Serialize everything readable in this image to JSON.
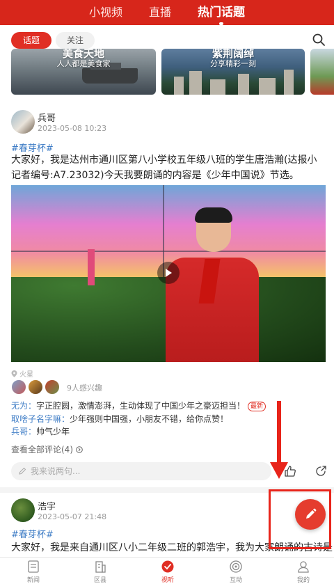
{
  "top_tabs": [
    {
      "label": "小视频"
    },
    {
      "label": "直播"
    },
    {
      "label": "热门话题"
    }
  ],
  "filters": {
    "topic": "话题",
    "follow": "关注"
  },
  "banners": [
    {
      "title": "美食天地",
      "subtitle": "人人都是美食家"
    },
    {
      "title": "紫荆阔绰",
      "subtitle": "分享精彩一刻"
    }
  ],
  "post1": {
    "author": "兵哥",
    "time": "2023-05-08 10:23",
    "hashtag": "#春芽杯#",
    "text": "大家好，我是达州市通川区第八小学校五年级八班的学生唐浩瀚(达报小记者编号:A7.23032)今天我要朗诵的内容是《少年中国说》节选。",
    "location": "火星",
    "interest_count": "9人感兴趣",
    "comments": [
      {
        "who": "无为：",
        "text": "字正腔圆，激情澎湃，生动体现了中国少年之豪迈担当！",
        "badge": "最新"
      },
      {
        "who": "取啥子名字嘛：",
        "text": "少年强则中国强，小朋友不错，给你点赞！"
      },
      {
        "who": "兵哥：",
        "text": "帅气少年"
      }
    ],
    "view_all": "查看全部评论(4)",
    "comment_placeholder": "我来说两句..."
  },
  "post2": {
    "author": "浩宇",
    "time": "2023-05-07 21:48",
    "hashtag": "#春芽杯#",
    "text": "大家好，我是来自通川区八小二年级二班的郭浩宇，我为大家朗诵的古诗是《赠汪"
  },
  "bottom_nav": [
    {
      "label": "新闻"
    },
    {
      "label": "区县"
    },
    {
      "label": "视听"
    },
    {
      "label": "互动"
    },
    {
      "label": "我的"
    }
  ],
  "colors": {
    "brand_red": "#d7261b",
    "link_blue": "#3f7dc6"
  }
}
